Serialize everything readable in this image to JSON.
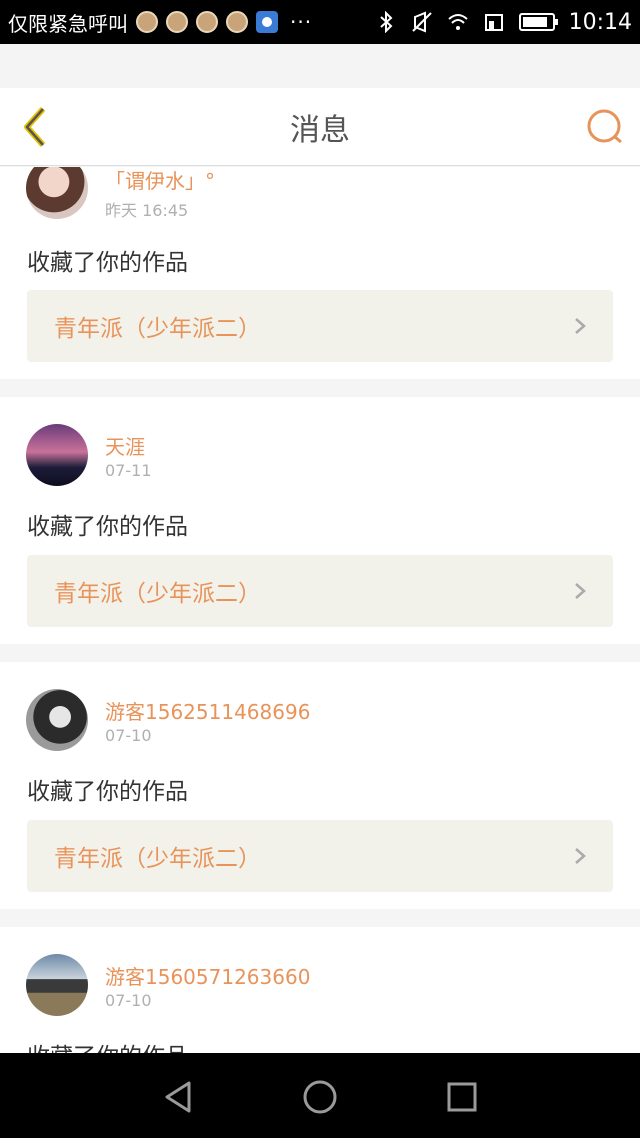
{
  "status_bar": {
    "carrier": "仅限紧急呼叫",
    "more": "···",
    "time": "10:14",
    "icons": [
      "notification-app-icon",
      "notification-app-icon",
      "notification-app-icon",
      "notification-app-icon",
      "baidu-paw-icon",
      "bluetooth-icon",
      "vibrate-off-icon",
      "wifi-icon",
      "data-icon",
      "battery-icon"
    ]
  },
  "header": {
    "title": "消息"
  },
  "colors": {
    "accent": "#e8935a",
    "back_arrow": "#e7c100",
    "card_bg": "#f3f2ea"
  },
  "messages": [
    {
      "user": "「谓伊水」°",
      "time": "昨天 16:45",
      "action": "收藏了你的作品",
      "work": "青年派（少年派二）"
    },
    {
      "user": "天涯",
      "time": "07-11",
      "action": "收藏了你的作品",
      "work": "青年派（少年派二）"
    },
    {
      "user": "游客1562511468696",
      "time": "07-10",
      "action": "收藏了你的作品",
      "work": "青年派（少年派二）"
    },
    {
      "user": "游客1560571263660",
      "time": "07-10",
      "action": "收藏了你的作品",
      "work": ""
    }
  ]
}
